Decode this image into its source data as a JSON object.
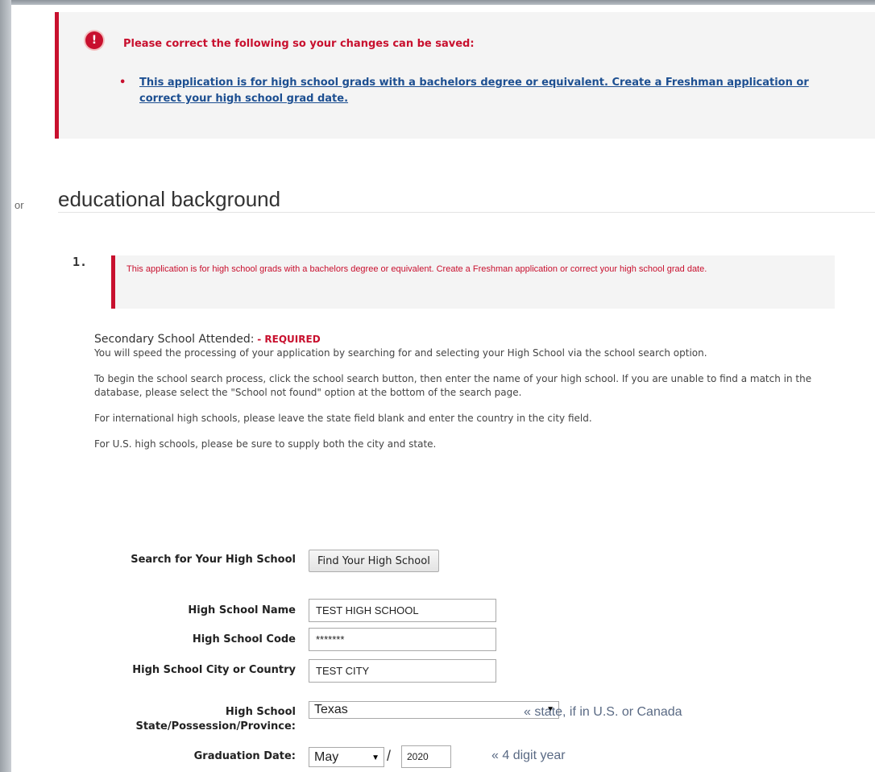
{
  "sidebar": {
    "fragment": "or"
  },
  "error_summary": {
    "title": "Please correct the following so your changes can be saved:",
    "items": [
      "This application is for high school grads with a bachelors degree or equivalent. Create a Freshman application or correct your high school grad date."
    ]
  },
  "section": {
    "title": "educational background"
  },
  "question": {
    "number": "1.",
    "error": "This application is for high school grads with a bachelors degree or equivalent. Create a Freshman application or correct your high school grad date.",
    "label": "Secondary School Attended:",
    "required": "- REQUIRED",
    "paragraphs": [
      "You will speed the processing of your application by searching for and selecting your High School via the school search option.",
      "To begin the school search process, click the school search button, then enter the name of your high school. If you are unable to find a match in the database, please select the \"School not found\" option at the bottom of the search page.",
      "For international high schools, please leave the state field blank and enter the country in the city field.",
      "For U.S. high schools, please be sure to supply both the city and state."
    ]
  },
  "form": {
    "search_label": "Search for Your High School",
    "search_button": "Find Your High School",
    "name_label": "High School Name",
    "name_value": "TEST HIGH SCHOOL",
    "code_label": "High School Code",
    "code_value": "*******",
    "city_label": "High School City or Country",
    "city_value": "TEST CITY",
    "state_label": "High School State/Possession/Province:",
    "state_value": "Texas",
    "state_hint": "« state, if in U.S. or Canada",
    "grad_label": "Graduation Date:",
    "grad_month": "May",
    "grad_separator": "/",
    "grad_year": "2020",
    "grad_hint": "« 4 digit year"
  }
}
